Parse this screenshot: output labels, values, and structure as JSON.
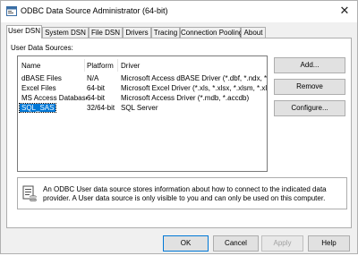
{
  "window": {
    "title": "ODBC Data Source Administrator (64-bit)",
    "close_glyph": "✕"
  },
  "tabs": [
    {
      "label": "User DSN",
      "active": true
    },
    {
      "label": "System DSN"
    },
    {
      "label": "File DSN"
    },
    {
      "label": "Drivers"
    },
    {
      "label": "Tracing"
    },
    {
      "label": "Connection Pooling"
    },
    {
      "label": "About"
    }
  ],
  "panel": {
    "list_label": "User Data Sources:",
    "columns": [
      "Name",
      "Platform",
      "Driver"
    ],
    "rows": [
      {
        "name": "dBASE Files",
        "platform": "N/A",
        "driver": "Microsoft Access dBASE Driver (*.dbf, *.ndx, *.m"
      },
      {
        "name": "Excel Files",
        "platform": "64-bit",
        "driver": "Microsoft Excel Driver (*.xls, *.xlsx, *.xlsm, *.xlsb"
      },
      {
        "name": "MS Access Database",
        "platform": "64-bit",
        "driver": "Microsoft Access Driver (*.mdb, *.accdb)"
      },
      {
        "name": "SQL_SAS",
        "platform": "32/64-bit",
        "driver": "SQL Server",
        "selected": true
      }
    ],
    "buttons": {
      "add": "Add...",
      "remove": "Remove",
      "configure": "Configure..."
    },
    "info_text": "An ODBC User data source stores information about how to connect to the indicated data provider.  A User data source is only visible to you and can only be used on this computer."
  },
  "footer": {
    "ok": "OK",
    "cancel": "Cancel",
    "apply": "Apply",
    "help": "Help"
  }
}
